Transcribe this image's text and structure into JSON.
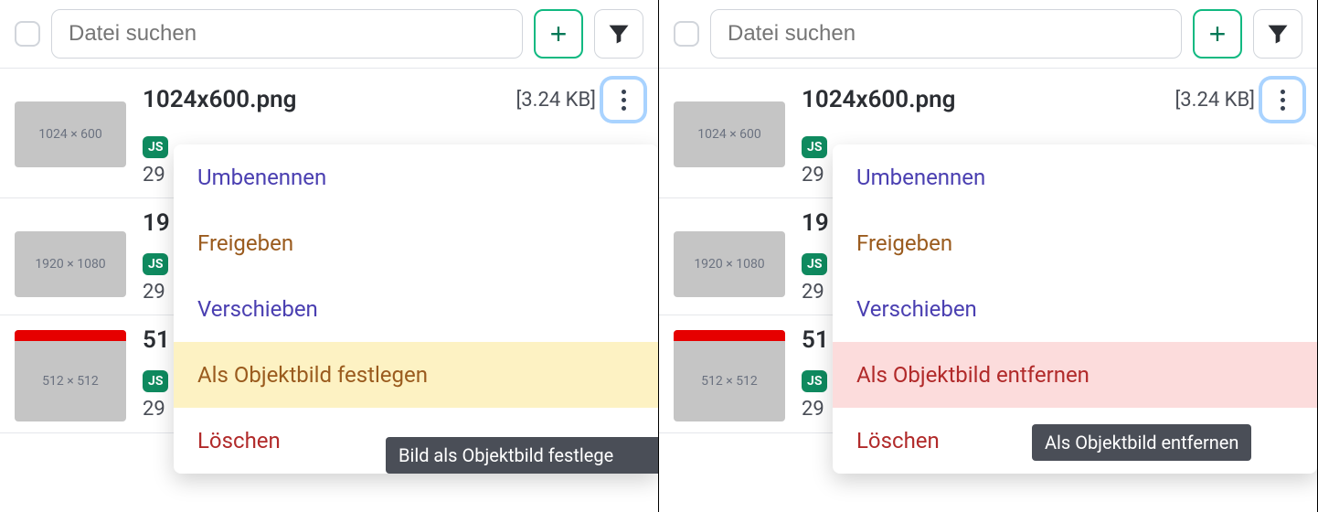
{
  "search": {
    "placeholder": "Datei suchen"
  },
  "add_label": "+",
  "files": [
    {
      "name": "1024x600.png",
      "size": "[3.24 KB]",
      "thumb": "1024 × 600",
      "badge": "JS",
      "meta": "29"
    },
    {
      "name": "19",
      "thumb": "1920 × 1080",
      "badge": "JS",
      "meta": "29"
    },
    {
      "name": "51",
      "thumb": "512 × 512",
      "badge": "JS",
      "meta": "29"
    }
  ],
  "menu_left": {
    "items": [
      {
        "label": "Umbenennen",
        "cls": "mi-purple"
      },
      {
        "label": "Freigeben",
        "cls": "mi-brown"
      },
      {
        "label": "Verschieben",
        "cls": "mi-purple"
      },
      {
        "label": "Als Objektbild festlegen",
        "cls": "mi-hl-yellow"
      },
      {
        "label": "Löschen",
        "cls": "mi-red"
      }
    ],
    "tooltip": "Bild als Objektbild festlege"
  },
  "menu_right": {
    "items": [
      {
        "label": "Umbenennen",
        "cls": "mi-purple"
      },
      {
        "label": "Freigeben",
        "cls": "mi-brown"
      },
      {
        "label": "Verschieben",
        "cls": "mi-purple"
      },
      {
        "label": "Als Objektbild entfernen",
        "cls": "mi-hl-pink"
      },
      {
        "label": "Löschen",
        "cls": "mi-red"
      }
    ],
    "tooltip": "Als Objektbild entfernen"
  }
}
